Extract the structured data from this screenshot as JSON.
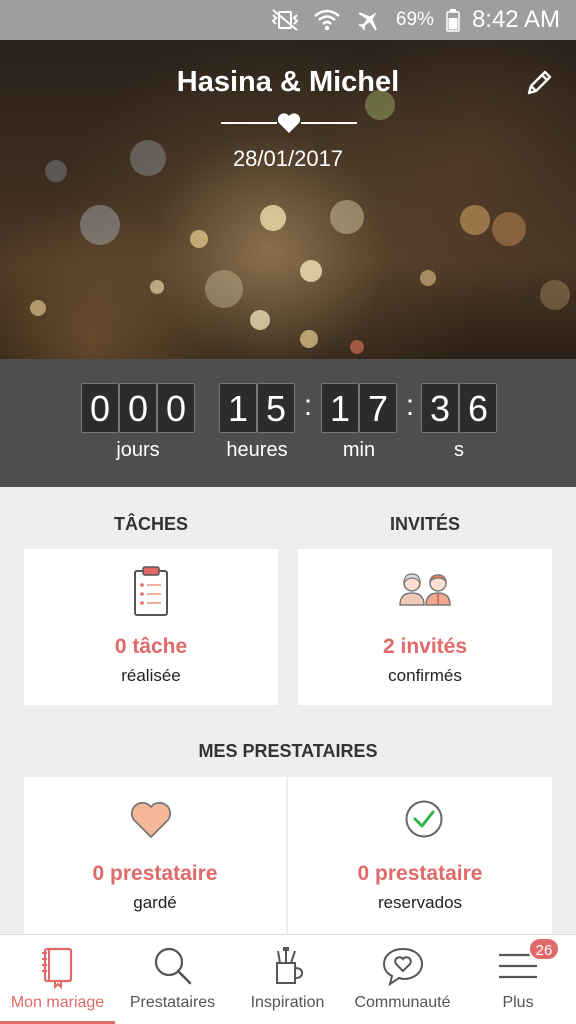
{
  "status_bar": {
    "battery": "69%",
    "time": "8:42 AM"
  },
  "hero": {
    "title": "Hasina & Michel",
    "date": "28/01/2017"
  },
  "countdown": {
    "days": [
      "0",
      "0",
      "0"
    ],
    "hours": [
      "1",
      "5"
    ],
    "minutes": [
      "1",
      "7"
    ],
    "seconds": [
      "3",
      "6"
    ],
    "separator": ":",
    "labels": {
      "days": "jours",
      "hours": "heures",
      "minutes": "min",
      "seconds": "s"
    }
  },
  "tasks": {
    "title": "TÂCHES",
    "count": "0 tâche",
    "sub": "réalisée"
  },
  "guests": {
    "title": "INVITÉS",
    "count": "2 invités",
    "sub": "confirmés"
  },
  "vendors": {
    "title": "MES PRESTATAIRES",
    "kept": {
      "count": "0 prestataire",
      "sub": "gardé"
    },
    "booked": {
      "count": "0 prestataire",
      "sub": "reservados"
    }
  },
  "nav": {
    "items": [
      {
        "label": "Mon mariage",
        "icon": "book-icon"
      },
      {
        "label": "Prestataires",
        "icon": "search-icon"
      },
      {
        "label": "Inspiration",
        "icon": "pencil-cup-icon"
      },
      {
        "label": "Communauté",
        "icon": "chat-heart-icon"
      },
      {
        "label": "Plus",
        "icon": "menu-icon"
      }
    ],
    "badge": "26"
  },
  "colors": {
    "accent": "#e06a6a",
    "countdown_bg": "#4e4e4e",
    "status_bar": "#9e9e9e"
  }
}
